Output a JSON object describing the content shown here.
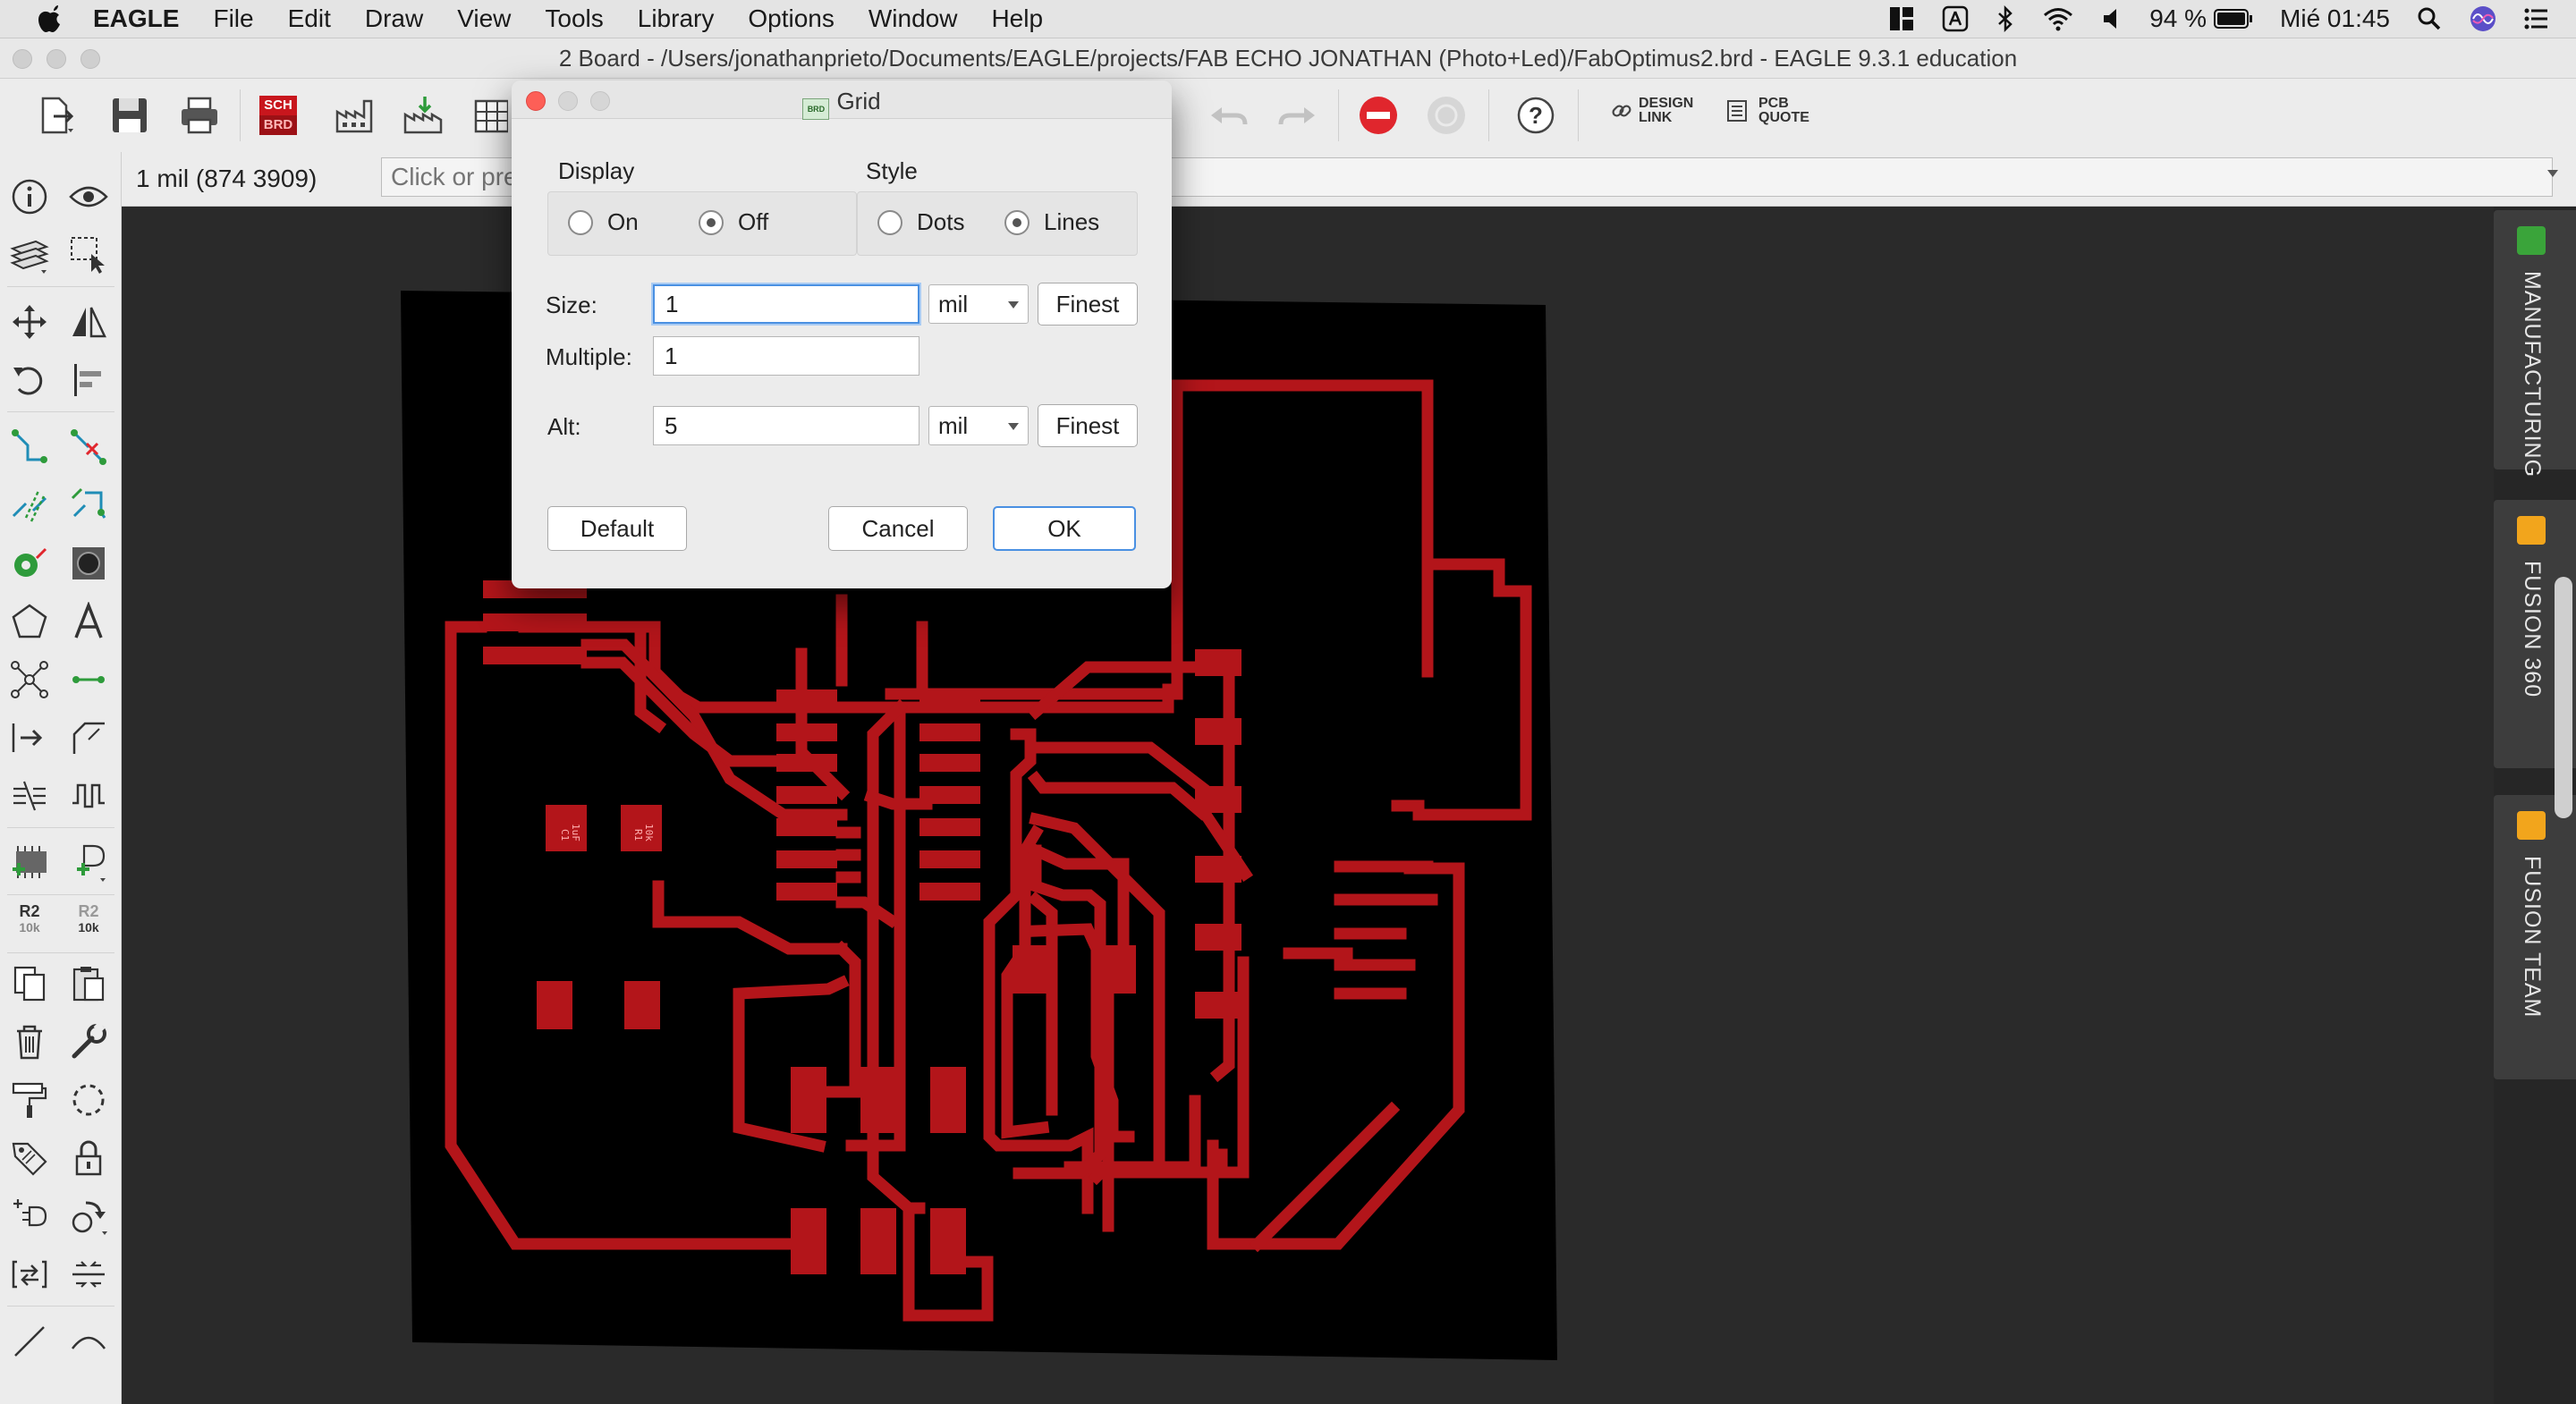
{
  "menubar": {
    "app": "EAGLE",
    "items": [
      "File",
      "Edit",
      "Draw",
      "View",
      "Tools",
      "Library",
      "Options",
      "Window",
      "Help"
    ],
    "battery": "94 %",
    "clock": "Mié 01:45"
  },
  "window": {
    "title": "2 Board - /Users/jonathanprieto/Documents/EAGLE/projects/FAB ECHO JONATHAN (Photo+Led)/FabOptimus2.brd - EAGLE 9.3.1 education"
  },
  "toolbar": {
    "sch_label": "SCH",
    "brd_label": "BRD",
    "design_link_label": "DESIGN LINK",
    "pcb_quote_label": "PCB QUOTE"
  },
  "command": {
    "coords": "1 mil (874 3909)",
    "placeholder": "Click or press Ctrl+L key to activate command line mode"
  },
  "palette": {
    "r2_label": "R2",
    "r2_value": "10k"
  },
  "sidebar": {
    "panels": [
      "MANUFACTURING",
      "FUSION 360",
      "FUSION TEAM"
    ],
    "colors": {
      "manufacturing": "#3aa43a",
      "fusion": "#f2a51c"
    }
  },
  "dialog": {
    "title": "Grid",
    "display": {
      "label": "Display",
      "on": "On",
      "off": "Off",
      "selected": "Off"
    },
    "style": {
      "label": "Style",
      "dots": "Dots",
      "lines": "Lines",
      "selected": "Lines"
    },
    "size": {
      "label": "Size:",
      "value": "1",
      "unit": "mil",
      "finest": "Finest"
    },
    "multiple": {
      "label": "Multiple:",
      "value": "1"
    },
    "alt": {
      "label": "Alt:",
      "value": "5",
      "unit": "mil",
      "finest": "Finest"
    },
    "buttons": {
      "default": "Default",
      "cancel": "Cancel",
      "ok": "OK"
    }
  },
  "board": {
    "copper_color": "#b3151a",
    "parts": [
      {
        "name": "C1",
        "value": "1uF"
      },
      {
        "name": "R1",
        "value": "10k"
      }
    ]
  }
}
